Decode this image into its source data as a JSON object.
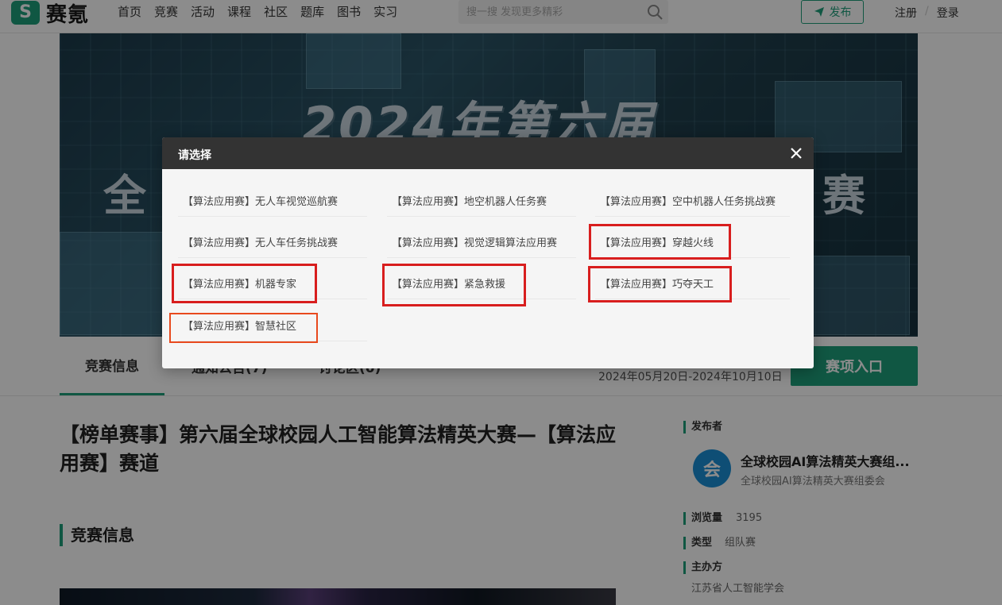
{
  "header": {
    "logo_text": "赛氪",
    "nav": [
      "首页",
      "竞赛",
      "活动",
      "课程",
      "社区",
      "题库",
      "图书",
      "实习"
    ],
    "search_placeholder": "搜一搜 发现更多精彩",
    "publish_label": "发布",
    "register_label": "注册",
    "auth_separator": "/",
    "login_label": "登录"
  },
  "banner": {
    "title": "2024年第六届",
    "left_fragment": "全",
    "right_fragment": "赛"
  },
  "tabs": {
    "items": [
      "竞赛信息",
      "通知公告(7)",
      "讨论区(0)"
    ],
    "active_index": 0,
    "date_range": "2024年05月20日-2024年10月10日",
    "entry_button": "赛项入口"
  },
  "main": {
    "title": "【榜单赛事】第六届全球校园人工智能算法精英大赛—【算法应用赛】赛道",
    "section_title": "竞赛信息"
  },
  "sidebar": {
    "publisher_label": "发布者",
    "publisher_avatar": "会",
    "publisher_name": "全球校园AI算法精英大赛组...",
    "publisher_desc": "全球校园AI算法精英大赛组委会",
    "views_label": "浏览量",
    "views_value": "3195",
    "type_label": "类型",
    "type_value": "组队赛",
    "organizer_label": "主办方",
    "organizer_value": "江苏省人工智能学会"
  },
  "modal": {
    "title": "请选择",
    "options": [
      "【算法应用赛】无人车视觉巡航赛",
      "【算法应用赛】地空机器人任务赛",
      "【算法应用赛】空中机器人任务挑战赛",
      "【算法应用赛】无人车任务挑战赛",
      "【算法应用赛】视觉逻辑算法应用赛",
      "【算法应用赛】穿越火线",
      "【算法应用赛】机器专家",
      "【算法应用赛】紧急救援",
      "【算法应用赛】巧夺天工",
      "【算法应用赛】智慧社区"
    ]
  },
  "colors": {
    "brand_green": "#1e9e7b",
    "highlight_red": "#d81e1e",
    "highlight_orange": "#e8491d",
    "modal_header": "#333333"
  }
}
